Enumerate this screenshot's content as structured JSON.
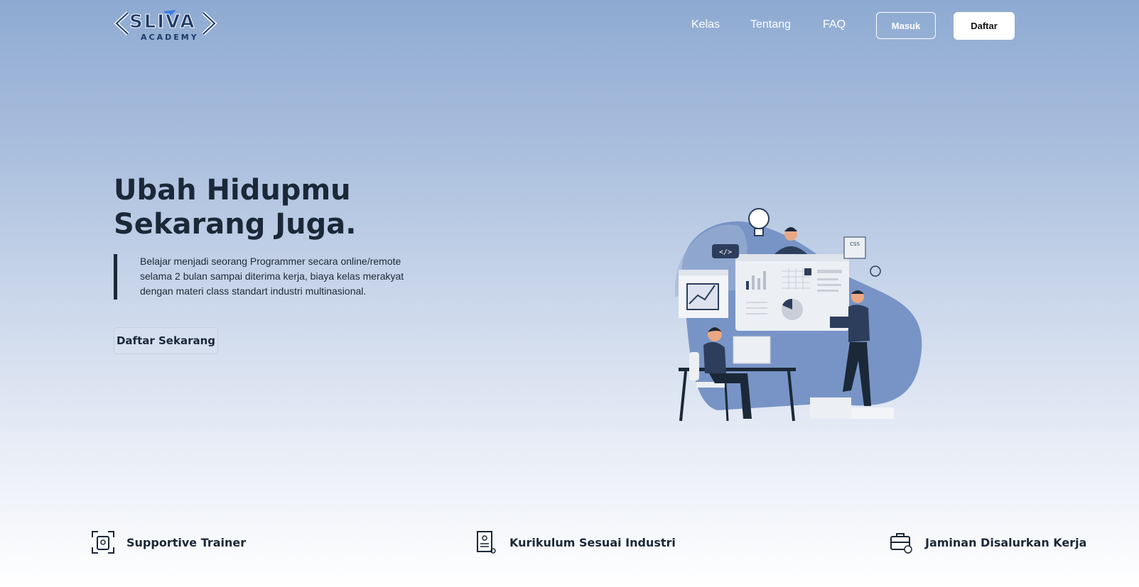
{
  "brand": {
    "name": "SLIVA",
    "tagline": "ACADEMY"
  },
  "nav": {
    "links": [
      "Kelas",
      "Tentang",
      "FAQ"
    ],
    "login_label": "Masuk",
    "register_label": "Daftar"
  },
  "hero": {
    "title_line1": "Ubah Hidupmu",
    "title_line2": "Sekarang Juga.",
    "description": "Belajar menjadi seorang Programmer secara online/remote selama 2 bulan sampai diterima kerja, biaya kelas merakyat dengan materi class standart industri multinasional.",
    "cta_label": "Daftar Sekarang",
    "illustration_icon": "team-working-illustration"
  },
  "features": [
    {
      "label": "Supportive Trainer",
      "icon": "trainer-badge-icon"
    },
    {
      "label": "Kurikulum Sesuai Industri",
      "icon": "certificate-icon"
    },
    {
      "label": "Jaminan Disalurkan Kerja",
      "icon": "briefcase-icon"
    }
  ],
  "colors": {
    "primary": "#1b2838",
    "accent": "#5c7fb8",
    "background_top": "#8eaad2"
  }
}
